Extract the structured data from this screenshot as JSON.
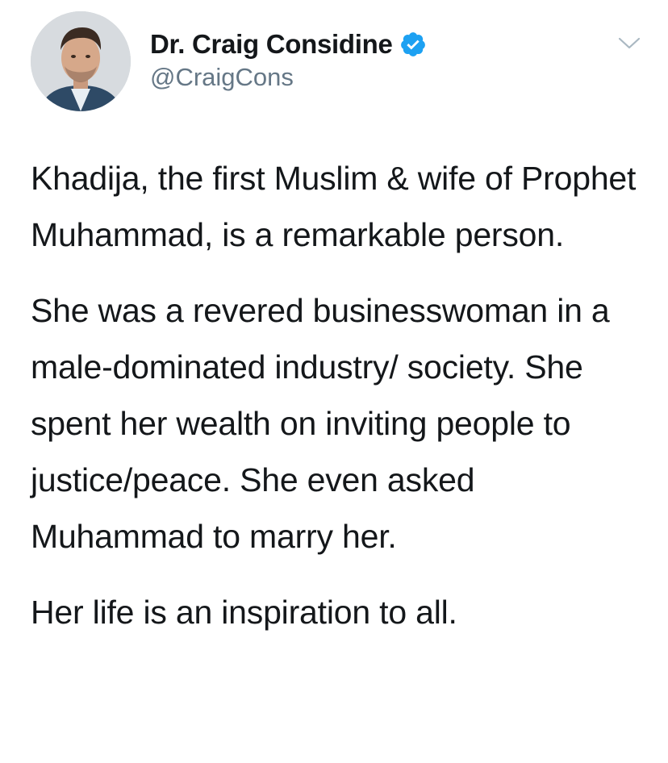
{
  "user": {
    "display_name": "Dr. Craig Considine",
    "handle": "@CraigCons",
    "verified": true
  },
  "icons": {
    "verified": "verified-badge-icon",
    "menu": "chevron-down-icon"
  },
  "colors": {
    "verified_blue": "#1da1f2",
    "text": "#14171a",
    "muted": "#657786"
  },
  "tweet": {
    "paragraphs": [
      "Khadija, the first Muslim & wife of Prophet Muhammad, is a remarkable person.",
      "She was a revered businesswoman in a male-dominated industry/ society. She spent her wealth on inviting people to justice/peace. She even asked Muhammad to marry her.",
      "Her life is an inspiration to all."
    ]
  }
}
